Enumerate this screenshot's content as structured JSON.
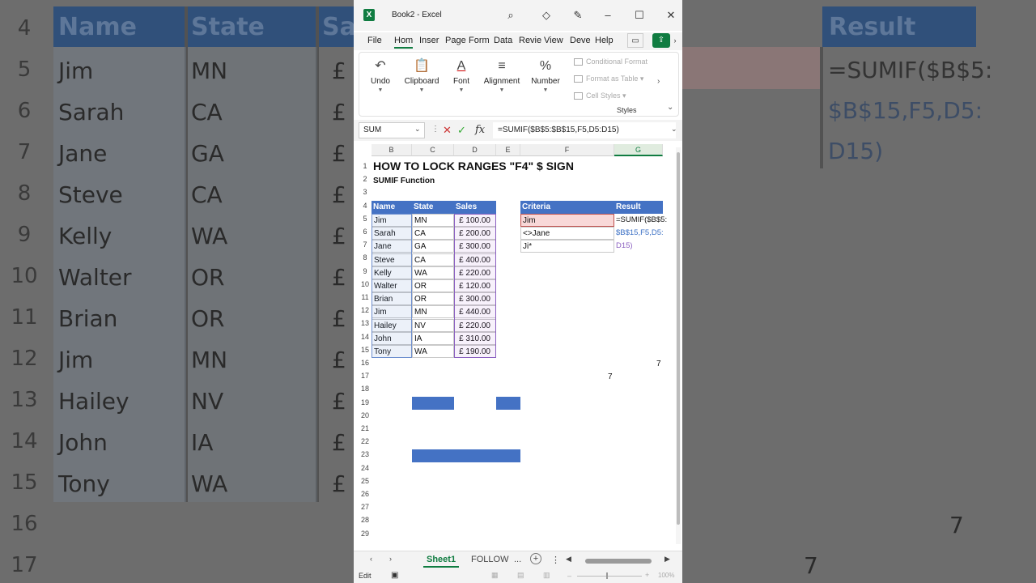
{
  "background": {
    "rows": [
      "4",
      "5",
      "6",
      "7",
      "8",
      "9",
      "10",
      "11",
      "12",
      "13",
      "14",
      "15",
      "16",
      "17"
    ],
    "names": [
      "Name",
      "Jim",
      "Sarah",
      "Jane",
      "Steve",
      "Kelly",
      "Walter",
      "Brian",
      "Jim",
      "Hailey",
      "John",
      "Tony"
    ],
    "states": [
      "State",
      "MN",
      "CA",
      "GA",
      "CA",
      "WA",
      "OR",
      "OR",
      "MN",
      "NV",
      "IA",
      "WA"
    ],
    "sales_partial": "Sa",
    "pound_glyph": "£",
    "result_header": "Result",
    "formula_lines": [
      "=SUMIF($B$5:",
      "$B$15,F5,D5:",
      "D15)"
    ],
    "seven": "7"
  },
  "window": {
    "title": "Book2  -  Excel",
    "logo": "X"
  },
  "menu": [
    "File",
    "Hom",
    "Inser",
    "Page",
    "Form",
    "Data",
    "Revie",
    "View",
    "Deve",
    "Help"
  ],
  "ribbon": {
    "groups": [
      {
        "label": "Undo",
        "icon": "↶"
      },
      {
        "label": "Clipboard",
        "icon": "📋"
      },
      {
        "label": "Font",
        "icon": "A"
      },
      {
        "label": "Alignment",
        "icon": "≡"
      },
      {
        "label": "Number",
        "icon": "%"
      }
    ],
    "styles": [
      "Conditional Format",
      "Format as Table",
      "Cell Styles"
    ],
    "styles_label": "Styles"
  },
  "formula_bar": {
    "name_box": "SUM",
    "formula": "=SUMIF($B$5:$B$15,F5,D5:D15)"
  },
  "columns": [
    "B",
    "C",
    "D",
    "E",
    "F",
    "G"
  ],
  "rows": [
    "1",
    "2",
    "3",
    "4",
    "5",
    "6",
    "7",
    "8",
    "9",
    "10",
    "11",
    "12",
    "13",
    "14",
    "15",
    "16",
    "17",
    "18",
    "19",
    "20",
    "21",
    "22",
    "23",
    "24",
    "25",
    "26",
    "27",
    "28",
    "29"
  ],
  "sheet": {
    "title": "HOW TO LOCK RANGES \"F4\" $ SIGN",
    "subtitle": "SUMIF Function",
    "headers": [
      "Name",
      "State",
      "Sales"
    ],
    "data": [
      [
        "Jim",
        "MN",
        "£ 100.00"
      ],
      [
        "Sarah",
        "CA",
        "£ 200.00"
      ],
      [
        "Jane",
        "GA",
        "£ 300.00"
      ],
      [
        "Steve",
        "CA",
        "£ 400.00"
      ],
      [
        "Kelly",
        "WA",
        "£ 220.00"
      ],
      [
        "Walter",
        "OR",
        "£ 120.00"
      ],
      [
        "Brian",
        "OR",
        "£ 300.00"
      ],
      [
        "Jim",
        "MN",
        "£ 440.00"
      ],
      [
        "Hailey",
        "NV",
        "£ 220.00"
      ],
      [
        "John",
        "IA",
        "£ 310.00"
      ],
      [
        "Tony",
        "WA",
        "£ 190.00"
      ]
    ],
    "criteria_header": "Criteria",
    "result_header": "Result",
    "criteria": [
      "Jim",
      "<>Jane",
      " Ji*"
    ],
    "result_lines": [
      "=SUMIF($B$5:",
      "$B$15,F5,D5:",
      "D15)"
    ],
    "stray_values": [
      "7",
      "7"
    ]
  },
  "tabs": [
    "Sheet1",
    "FOLLOW",
    "..."
  ],
  "status": {
    "mode": "Edit",
    "zoom": "100%"
  }
}
